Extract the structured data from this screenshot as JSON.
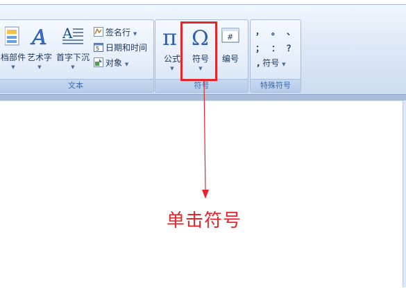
{
  "groups": {
    "text": {
      "label": "文本",
      "buttons": {
        "quick_parts": "档部件",
        "wordart": "艺术字",
        "drop_cap": "首字下沉"
      },
      "small_buttons": {
        "signature_line": "签名行",
        "date_time": "日期和时间",
        "object": "对象"
      }
    },
    "symbols": {
      "label": "符号",
      "buttons": {
        "equation": "公式",
        "symbol": "符号",
        "number": "编号"
      }
    },
    "special_symbols": {
      "label": "特殊符号",
      "grid": [
        "，",
        "。",
        "、",
        "；",
        "：",
        "？"
      ],
      "dropdown_label": "符号"
    }
  },
  "annotation": {
    "text": "单击符号"
  },
  "colors": {
    "highlight": "#e8232a",
    "ribbon_text": "#1e395b",
    "group_label": "#3e6aaa"
  }
}
